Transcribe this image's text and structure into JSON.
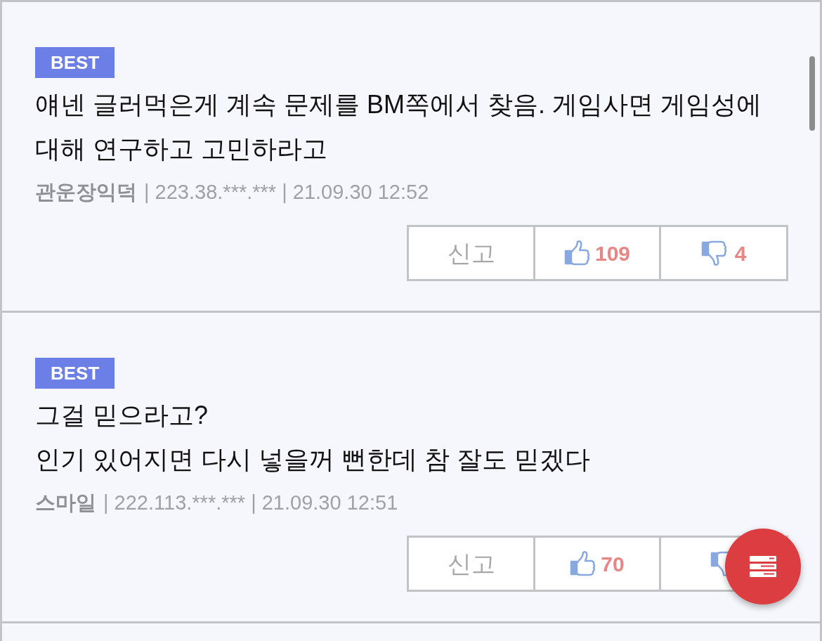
{
  "comments": [
    {
      "badge": "BEST",
      "text": "얘넨 글러먹은게 계속 문제를 BM쪽에서 찾음. 게임사면 게임성에 대해 연구하고 고민하라고",
      "author": "관운장익덕",
      "details": "| 223.38.***.*** | 21.09.30 12:52",
      "report_label": "신고",
      "like_count": "109",
      "dislike_count": "4"
    },
    {
      "badge": "BEST",
      "text": "그걸 믿으라고?\n인기 있어지면 다시 넣을꺼 뻔한데 참 잘도 믿겠다",
      "author": "스마일",
      "details": "| 222.113.***.*** | 21.09.30 12:51",
      "report_label": "신고",
      "like_count": "70"
    }
  ]
}
